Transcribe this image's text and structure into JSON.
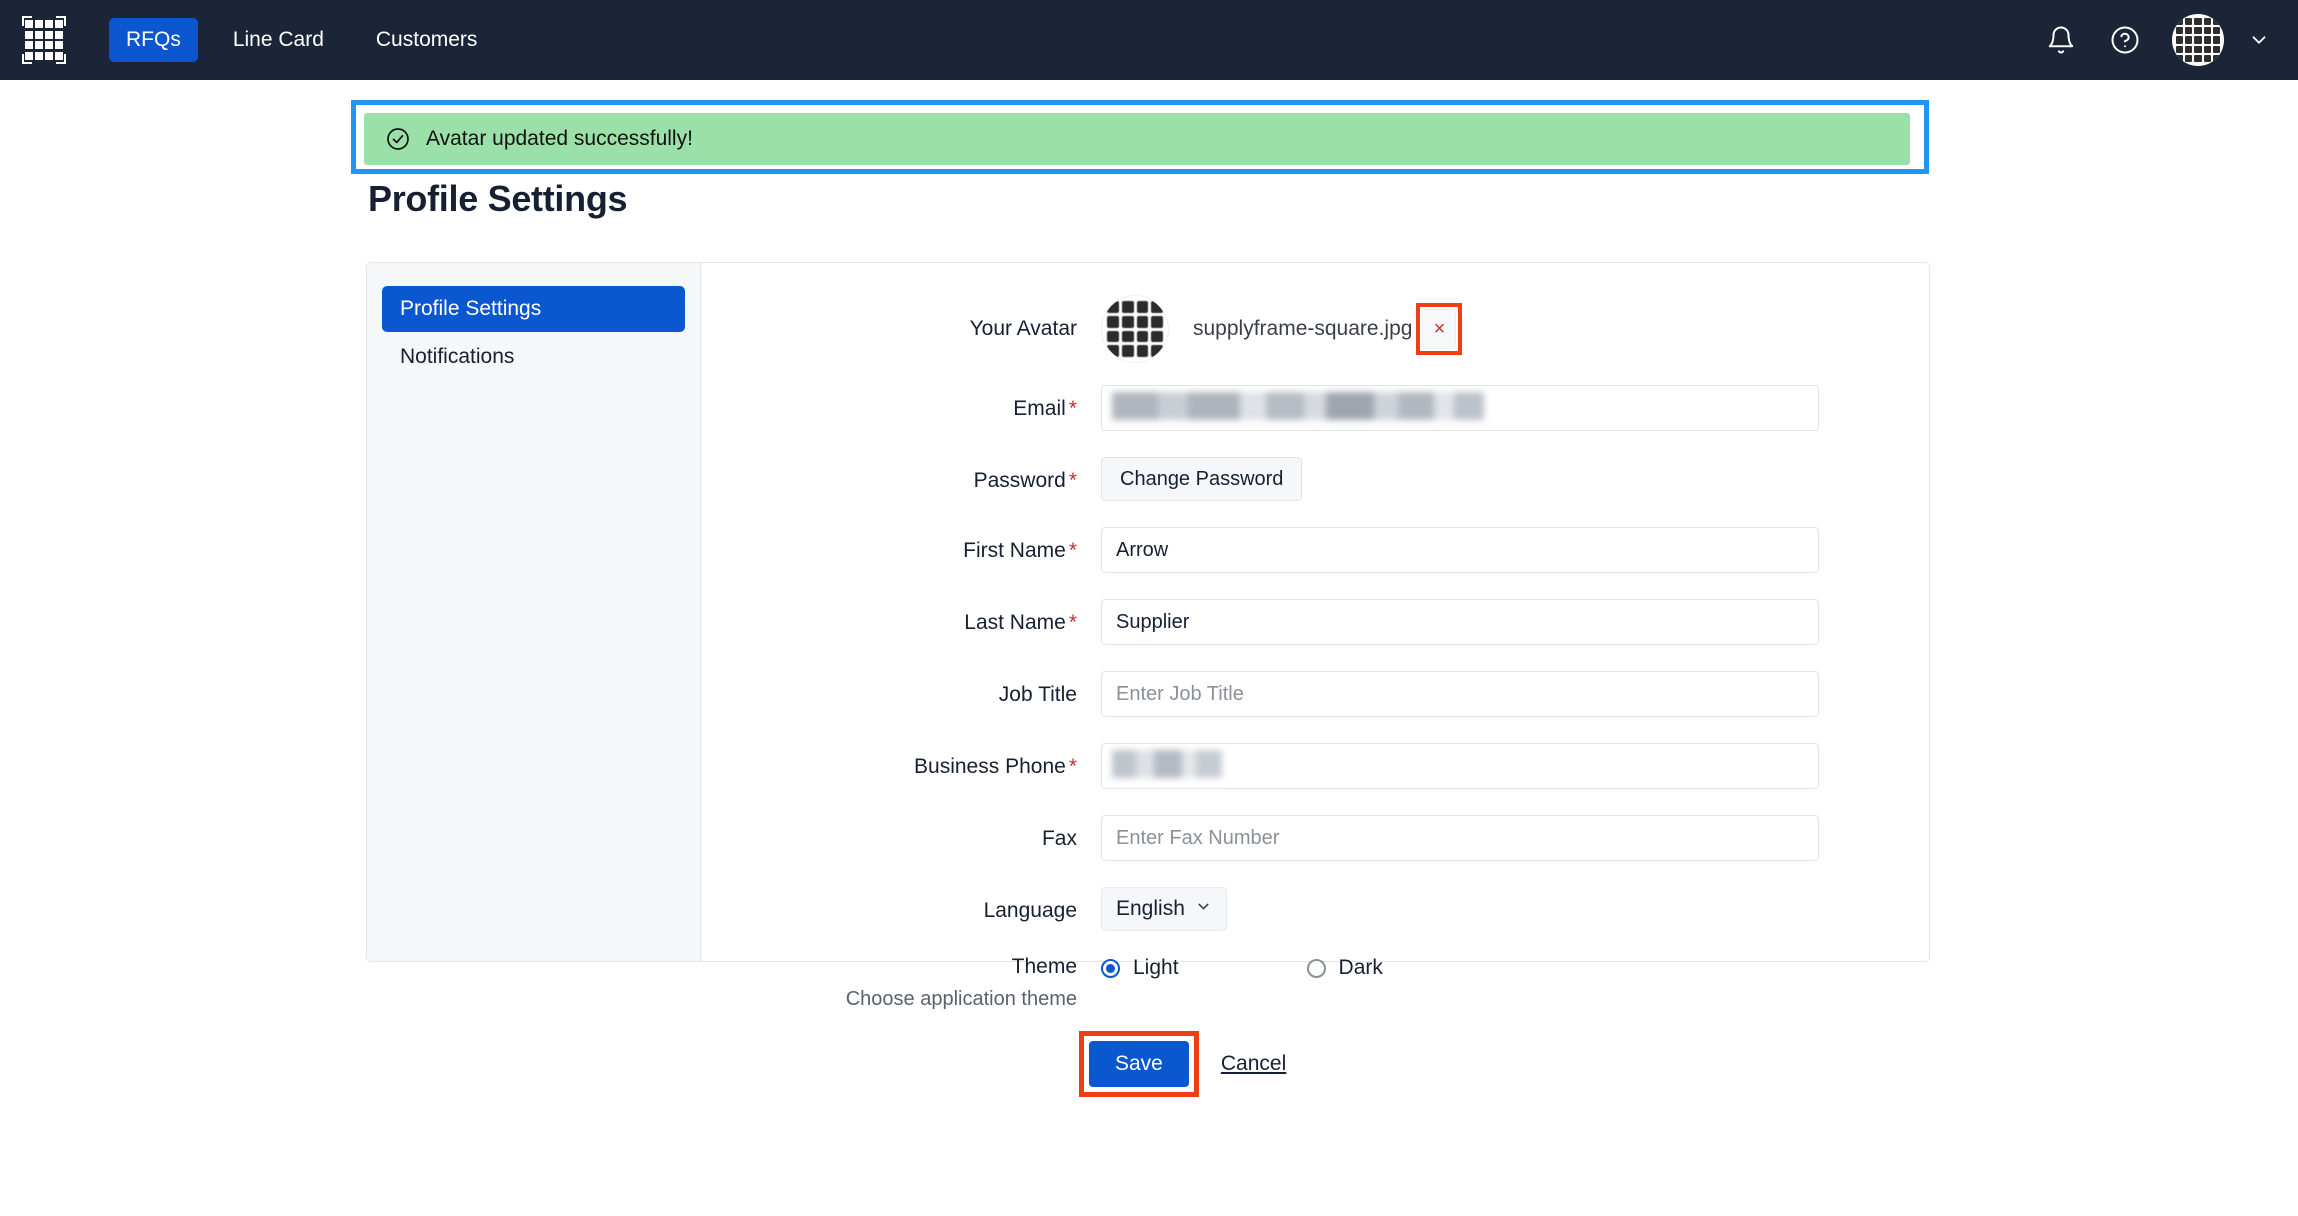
{
  "header": {
    "logo_name": "supplyframe-grid-logo",
    "nav": [
      {
        "label": "RFQs",
        "active": true
      },
      {
        "label": "Line Card",
        "active": false
      },
      {
        "label": "Customers",
        "active": false
      }
    ],
    "icons": {
      "notifications": "bell-icon",
      "help": "help-circle-icon",
      "avatar": "user-avatar",
      "chevron": "chevron-down-icon"
    },
    "brand_color": "#0b57d0",
    "background_color": "#1b2537"
  },
  "alert": {
    "message": "Avatar updated successfully!",
    "icon": "check-circle-icon",
    "background_color": "#9be0a8",
    "annotation_color": "#2196f3"
  },
  "page": {
    "title": "Profile Settings"
  },
  "sidebar": {
    "items": [
      {
        "label": "Profile Settings",
        "active": true
      },
      {
        "label": "Notifications",
        "active": false
      }
    ]
  },
  "form": {
    "avatar": {
      "label": "Your Avatar",
      "file_name": "supplyframe-square.jpg",
      "remove_label": "×",
      "annotation_color": "#f03e16"
    },
    "email": {
      "label": "Email",
      "required": "*",
      "value": "",
      "redacted": true
    },
    "password": {
      "label": "Password",
      "required": "*",
      "button_label": "Change Password"
    },
    "first_name": {
      "label": "First Name",
      "required": "*",
      "value": "Arrow"
    },
    "last_name": {
      "label": "Last Name",
      "required": "*",
      "value": "Supplier"
    },
    "job_title": {
      "label": "Job Title",
      "required": "",
      "value": "",
      "placeholder": "Enter Job Title"
    },
    "business_phone": {
      "label": "Business Phone",
      "required": "*",
      "value": "",
      "redacted": true
    },
    "fax": {
      "label": "Fax",
      "required": "",
      "value": "",
      "placeholder": "Enter Fax Number"
    },
    "language": {
      "label": "Language",
      "selected": "English",
      "chevron": "chevron-down-icon"
    },
    "theme": {
      "label": "Theme",
      "helper": "Choose application theme",
      "options": [
        {
          "label": "Light",
          "selected": true
        },
        {
          "label": "Dark",
          "selected": false
        }
      ]
    },
    "actions": {
      "save_label": "Save",
      "cancel_label": "Cancel",
      "save_annotation_color": "#f03e16"
    }
  }
}
